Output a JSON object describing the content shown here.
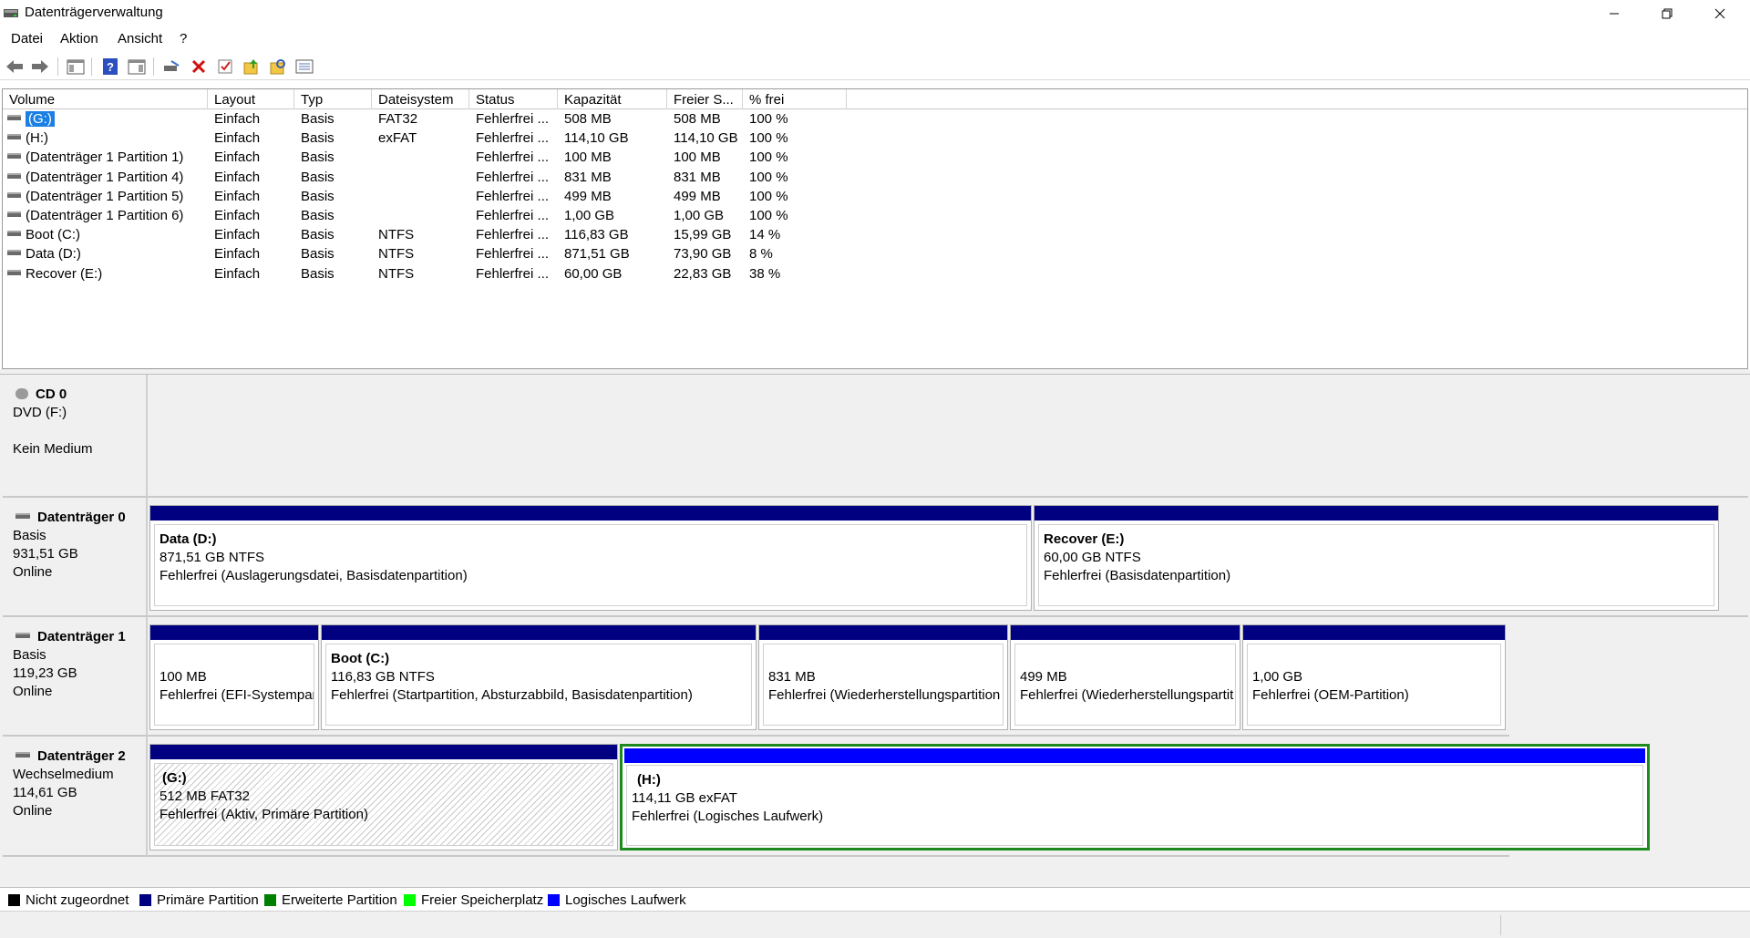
{
  "window": {
    "title": "Datenträgerverwaltung",
    "minimize_icon": "minimize-icon",
    "restore_icon": "restore-icon",
    "close_icon": "close-icon"
  },
  "menu": [
    "Datei",
    "Aktion",
    "Ansicht",
    "?"
  ],
  "toolbar": [
    "back-icon",
    "forward-icon",
    "show-hide-console-tree-icon",
    "help-icon",
    "properties-view-icon",
    "connect-disk-icon",
    "delete-icon",
    "check-icon",
    "open-folder-up-icon",
    "explore-folder-icon",
    "list-view-icon"
  ],
  "volume_list": {
    "columns": [
      "Volume",
      "Layout",
      "Typ",
      "Dateisystem",
      "Status",
      "Kapazität",
      "Freier S...",
      "% frei"
    ],
    "rows": [
      {
        "volume": "(G:)",
        "layout": "Einfach",
        "typ": "Basis",
        "fs": "FAT32",
        "status": "Fehlerfrei ...",
        "capacity": "508 MB",
        "free": "508 MB",
        "pct": "100 %"
      },
      {
        "volume": "(H:)",
        "layout": "Einfach",
        "typ": "Basis",
        "fs": "exFAT",
        "status": "Fehlerfrei ...",
        "capacity": "114,10 GB",
        "free": "114,10 GB",
        "pct": "100 %"
      },
      {
        "volume": "(Datenträger 1 Partition 1)",
        "layout": "Einfach",
        "typ": "Basis",
        "fs": "",
        "status": "Fehlerfrei ...",
        "capacity": "100 MB",
        "free": "100 MB",
        "pct": "100 %"
      },
      {
        "volume": "(Datenträger 1 Partition 4)",
        "layout": "Einfach",
        "typ": "Basis",
        "fs": "",
        "status": "Fehlerfrei ...",
        "capacity": "831 MB",
        "free": "831 MB",
        "pct": "100 %"
      },
      {
        "volume": "(Datenträger 1 Partition 5)",
        "layout": "Einfach",
        "typ": "Basis",
        "fs": "",
        "status": "Fehlerfrei ...",
        "capacity": "499 MB",
        "free": "499 MB",
        "pct": "100 %"
      },
      {
        "volume": "(Datenträger 1 Partition 6)",
        "layout": "Einfach",
        "typ": "Basis",
        "fs": "",
        "status": "Fehlerfrei ...",
        "capacity": "1,00 GB",
        "free": "1,00 GB",
        "pct": "100 %"
      },
      {
        "volume": "Boot (C:)",
        "layout": "Einfach",
        "typ": "Basis",
        "fs": "NTFS",
        "status": "Fehlerfrei ...",
        "capacity": "116,83 GB",
        "free": "15,99 GB",
        "pct": "14 %"
      },
      {
        "volume": "Data (D:)",
        "layout": "Einfach",
        "typ": "Basis",
        "fs": "NTFS",
        "status": "Fehlerfrei ...",
        "capacity": "871,51 GB",
        "free": "73,90 GB",
        "pct": "8 %"
      },
      {
        "volume": "Recover (E:)",
        "layout": "Einfach",
        "typ": "Basis",
        "fs": "NTFS",
        "status": "Fehlerfrei ...",
        "capacity": "60,00 GB",
        "free": "22,83 GB",
        "pct": "38 %"
      }
    ]
  },
  "disks": {
    "cd0": {
      "title": "CD 0",
      "line1": "DVD (F:)",
      "line2": "",
      "line3": "Kein Medium"
    },
    "disk0": {
      "title": "Datenträger 0",
      "line1": "Basis",
      "line2": "931,51 GB",
      "line3": "Online",
      "partitions": [
        {
          "name": "Data  (D:)",
          "size": "871,51 GB NTFS",
          "status": "Fehlerfrei (Auslagerungsdatei, Basisdatenpartition)"
        },
        {
          "name": "Recover  (E:)",
          "size": "60,00 GB NTFS",
          "status": "Fehlerfrei (Basisdatenpartition)"
        }
      ]
    },
    "disk1": {
      "title": "Datenträger 1",
      "line1": "Basis",
      "line2": "119,23 GB",
      "line3": "Online",
      "partitions": [
        {
          "name": "",
          "size": "100 MB",
          "status": "Fehlerfrei (EFI-Systempart"
        },
        {
          "name": "Boot  (C:)",
          "size": "116,83 GB NTFS",
          "status": "Fehlerfrei (Startpartition, Absturzabbild, Basisdatenpartition)"
        },
        {
          "name": "",
          "size": "831 MB",
          "status": "Fehlerfrei (Wiederherstellungspartition"
        },
        {
          "name": "",
          "size": "499 MB",
          "status": "Fehlerfrei (Wiederherstellungspartit"
        },
        {
          "name": "",
          "size": "1,00 GB",
          "status": "Fehlerfrei (OEM-Partition)"
        }
      ]
    },
    "disk2": {
      "title": "Datenträger 2",
      "line1": "Wechselmedium",
      "line2": "114,61 GB",
      "line3": "Online",
      "partitions": [
        {
          "name": "(G:)",
          "size": "512 MB FAT32",
          "status": "Fehlerfrei (Aktiv, Primäre Partition)"
        },
        {
          "name": "(H:)",
          "size": "114,11 GB exFAT",
          "status": "Fehlerfrei (Logisches Laufwerk)"
        }
      ]
    }
  },
  "legend": [
    {
      "label": "Nicht zugeordnet",
      "color": "#000000"
    },
    {
      "label": "Primäre Partition",
      "color": "#000080"
    },
    {
      "label": "Erweiterte Partition",
      "color": "#008000"
    },
    {
      "label": "Freier Speicherplatz",
      "color": "#00ff00"
    },
    {
      "label": "Logisches Laufwerk",
      "color": "#0000ff"
    }
  ]
}
